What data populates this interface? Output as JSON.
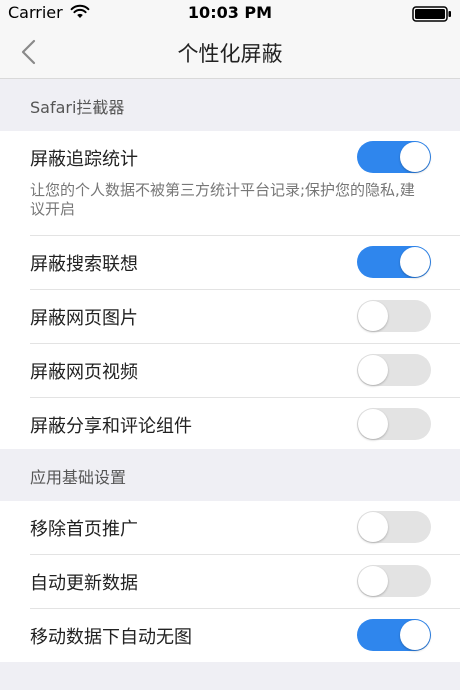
{
  "status_bar": {
    "carrier": "Carrier",
    "time": "10:03 PM",
    "wifi_icon": "wifi-icon",
    "battery_icon": "battery-icon"
  },
  "nav": {
    "back_icon": "chevron-left-icon",
    "title": "个性化屏蔽"
  },
  "colors": {
    "accent": "#2f86ed",
    "toggle_off": "#e3e3e3",
    "background": "#efeff4"
  },
  "sections": [
    {
      "header": "Safari拦截器",
      "rows": [
        {
          "label": "屏蔽追踪统计",
          "description": "让您的个人数据不被第三方统计平台记录;保护您的隐私,建议开启",
          "enabled": true
        },
        {
          "label": "屏蔽搜索联想",
          "enabled": true
        },
        {
          "label": "屏蔽网页图片",
          "enabled": false
        },
        {
          "label": "屏蔽网页视频",
          "enabled": false
        },
        {
          "label": "屏蔽分享和评论组件",
          "enabled": false
        }
      ]
    },
    {
      "header": "应用基础设置",
      "rows": [
        {
          "label": "移除首页推广",
          "enabled": false
        },
        {
          "label": "自动更新数据",
          "enabled": false
        },
        {
          "label": "移动数据下自动无图",
          "enabled": true
        }
      ]
    }
  ]
}
